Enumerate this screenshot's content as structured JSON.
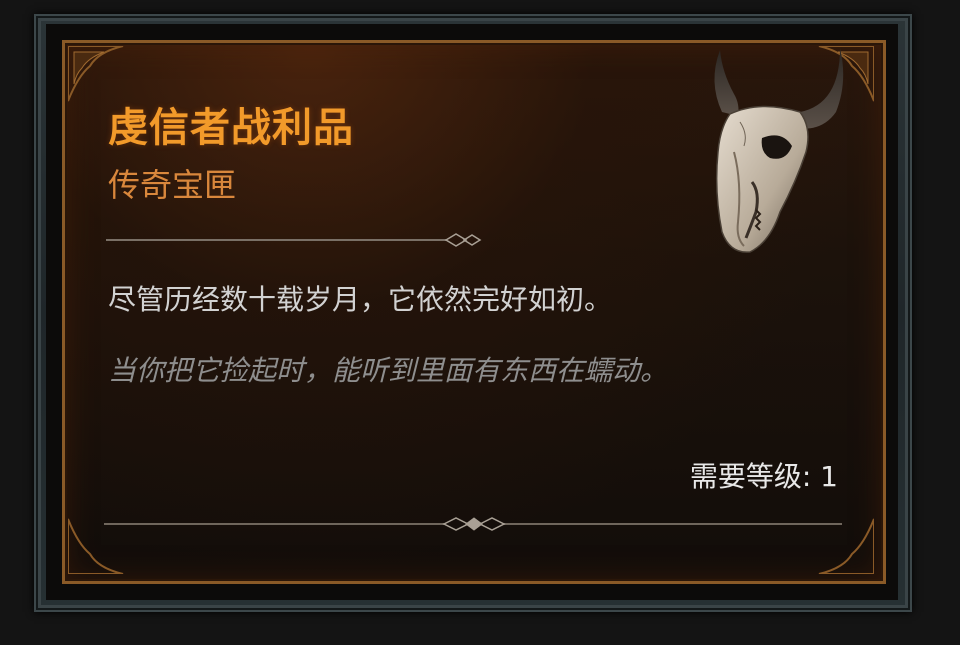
{
  "item": {
    "name": "虔信者战利品",
    "type": "传奇宝匣",
    "description": "尽管历经数十载岁月，它依然完好如初。",
    "flavor_text": "当你把它捡起时，能听到里面有东西在蠕动。",
    "requirement": "需要等级: 1",
    "icon": "horned-skull-icon"
  },
  "colors": {
    "title": "#f29a2a",
    "subtitle": "#d9873c",
    "description": "#d2d2d2",
    "flavor": "#8e8e8e",
    "border": "#8a5a27"
  }
}
